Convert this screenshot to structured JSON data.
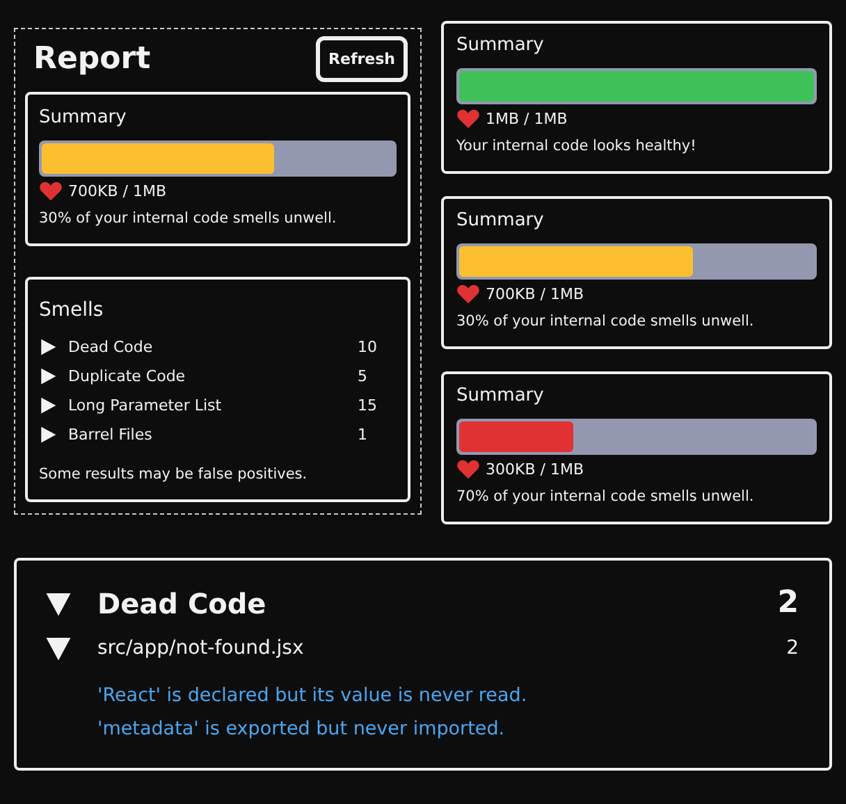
{
  "report": {
    "title": "Report",
    "refresh_button": "Refresh",
    "summary": {
      "title": "Summary",
      "level": 0.66,
      "color": "#fbbf2f",
      "size": "700KB / 1MB",
      "message": "30% of your internal code smells unwell."
    },
    "smells": {
      "title": "Smells",
      "items": [
        {
          "label": "Dead Code",
          "count": "10",
          "expanded": false
        },
        {
          "label": "Duplicate Code",
          "count": "5",
          "expanded": false
        },
        {
          "label": "Long Parameter List",
          "count": "15",
          "expanded": false
        },
        {
          "label": "Barrel Files",
          "count": "1",
          "expanded": false
        }
      ],
      "note": "Some results may be false positives."
    }
  },
  "summaries": [
    {
      "title": "Summary",
      "level": 1,
      "color": "#3fc15a",
      "size": "1MB / 1MB",
      "message": "Your internal code looks healthy!"
    },
    {
      "title": "Summary",
      "level": 0.66,
      "color": "#fbbf2f",
      "size": "700KB / 1MB",
      "message": "30% of your internal code smells unwell."
    },
    {
      "title": "Summary",
      "level": 0.32,
      "color": "#e03232",
      "size": "300KB / 1MB",
      "message": "70% of your internal code smells unwell."
    }
  ],
  "detail": {
    "title": "Dead Code",
    "count": "2",
    "expanded": true,
    "files": [
      {
        "path": "src/app/not-found.jsx",
        "count": "2",
        "expanded": true,
        "messages": [
          "'React' is declared but its value is never read.",
          "'metadata' is exported but never imported."
        ]
      }
    ]
  }
}
